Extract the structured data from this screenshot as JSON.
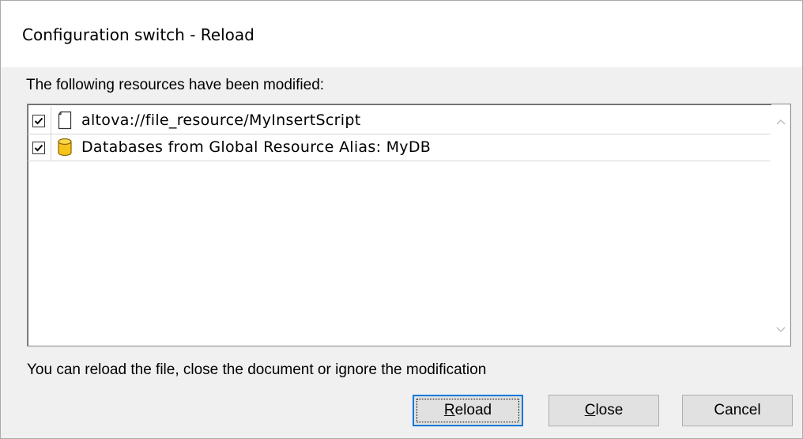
{
  "dialog": {
    "title": "Configuration switch - Reload",
    "header_label": "The following resources have been modified:",
    "footer_label": "You can reload the file, close the document or ignore the modification"
  },
  "resources": [
    {
      "checked": true,
      "icon": "file-icon",
      "label": "altova://file_resource/MyInsertScript"
    },
    {
      "checked": true,
      "icon": "database-icon",
      "label": "Databases from Global Resource Alias: MyDB"
    }
  ],
  "buttons": {
    "reload": {
      "mnemonic": "R",
      "rest": "eload"
    },
    "close": {
      "mnemonic": "C",
      "rest": "lose"
    },
    "cancel": {
      "label": "Cancel"
    }
  },
  "colors": {
    "accent": "#0078d7",
    "database": "#f7c31a"
  }
}
